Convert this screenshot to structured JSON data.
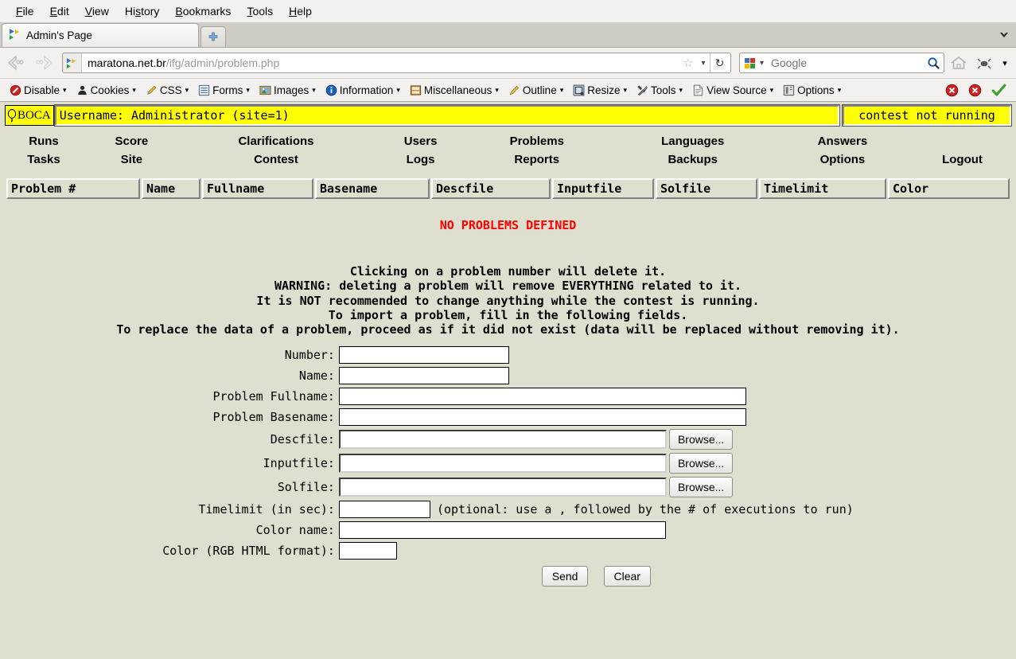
{
  "browser": {
    "menubar": [
      {
        "label": "File",
        "accel": "F"
      },
      {
        "label": "Edit",
        "accel": "E"
      },
      {
        "label": "View",
        "accel": "V"
      },
      {
        "label": "History",
        "accel": "s"
      },
      {
        "label": "Bookmarks",
        "accel": "B"
      },
      {
        "label": "Tools",
        "accel": "T"
      },
      {
        "label": "Help",
        "accel": "H"
      }
    ],
    "tab_title": "Admin's Page",
    "new_tab_label": "+",
    "url_prefix": "maratona.net.br",
    "url_suffix": "/ifg/admin/problem.php",
    "url_full": "maratona.net.br/ifg/admin/problem.php",
    "search_placeholder": "Google",
    "reload_glyph": "↻",
    "star_glyph": "☆",
    "caret_glyph": "⌄"
  },
  "devtoolbar": {
    "items": [
      {
        "label": "Disable",
        "icon": "no-entry-icon",
        "caret": true
      },
      {
        "label": "Cookies",
        "icon": "person-icon",
        "caret": true
      },
      {
        "label": "CSS",
        "icon": "pencil-icon",
        "caret": true
      },
      {
        "label": "Forms",
        "icon": "form-icon",
        "caret": true
      },
      {
        "label": "Images",
        "icon": "picture-icon",
        "caret": true
      },
      {
        "label": "Information",
        "icon": "info-icon",
        "caret": true
      },
      {
        "label": "Miscellaneous",
        "icon": "drawer-icon",
        "caret": true
      },
      {
        "label": "Outline",
        "icon": "marker-icon",
        "caret": true
      },
      {
        "label": "Resize",
        "icon": "resize-icon",
        "caret": true
      },
      {
        "label": "Tools",
        "icon": "tools-icon",
        "caret": true
      },
      {
        "label": "View Source",
        "icon": "document-icon",
        "caret": true
      },
      {
        "label": "Options",
        "icon": "options-icon",
        "caret": true
      }
    ],
    "status_icons": [
      "error-icon",
      "error-icon",
      "checkmark-icon"
    ]
  },
  "status": {
    "logo_text": "BOCA",
    "username_line": "Username: Administrator (site=1)",
    "contest_state": "contest not running"
  },
  "nav": {
    "row1": [
      "Runs",
      "Score",
      "Clarifications",
      "Users",
      "Problems",
      "Languages",
      "Answers",
      ""
    ],
    "row2": [
      "Tasks",
      "Site",
      "Contest",
      "Logs",
      "Reports",
      "Backups",
      "Options",
      "Logout"
    ]
  },
  "table": {
    "headers": [
      "Problem #",
      "Name",
      "Fullname",
      "Basename",
      "Descfile",
      "Inputfile",
      "Solfile",
      "Timelimit",
      "Color"
    ]
  },
  "messages": {
    "no_problems": "NO PROBLEMS DEFINED",
    "warn_lines": [
      "Clicking on a problem number will delete it.",
      "WARNING: deleting a problem will remove EVERYTHING related to it.",
      "It is NOT recommended to change anything while the contest is running.",
      "To import a problem, fill in the following fields.",
      "To replace the data of a problem, proceed as if it did not exist (data will be replaced without removing it)."
    ]
  },
  "form": {
    "fields": [
      {
        "label": "Number:",
        "value": "",
        "kind": "text"
      },
      {
        "label": "Name:",
        "value": "",
        "kind": "text"
      },
      {
        "label": "Problem Fullname:",
        "value": "",
        "kind": "text"
      },
      {
        "label": "Problem Basename:",
        "value": "",
        "kind": "text"
      },
      {
        "label": "Descfile:",
        "value": "",
        "kind": "file"
      },
      {
        "label": "Inputfile:",
        "value": "",
        "kind": "file"
      },
      {
        "label": "Solfile:",
        "value": "",
        "kind": "file"
      },
      {
        "label": "Timelimit (in sec):",
        "value": "",
        "kind": "text"
      },
      {
        "label": "Color name:",
        "value": "",
        "kind": "text"
      },
      {
        "label": "Color (RGB HTML format):",
        "value": "",
        "kind": "text"
      }
    ],
    "browse_label": "Browse...",
    "timelimit_hint": "(optional: use a , followed by the # of executions to run)",
    "send_label": "Send",
    "clear_label": "Clear"
  },
  "colors": {
    "page_bg": "#dfdfd0",
    "highlight_yellow": "#ffff00",
    "alert_red": "#ff0000"
  }
}
